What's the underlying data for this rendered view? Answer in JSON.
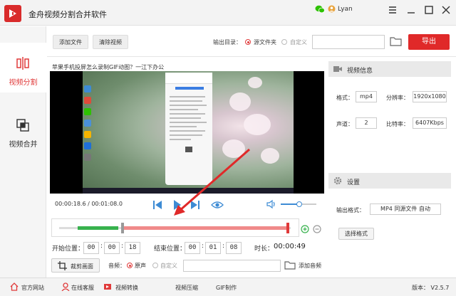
{
  "app": {
    "title": "金舟视频分割合并软件"
  },
  "user": {
    "name": "Lyan"
  },
  "sidebar": {
    "items": [
      {
        "label": "视频分割"
      },
      {
        "label": "视频合并"
      }
    ]
  },
  "toolbar": {
    "add_file": "添加文件",
    "clear_video": "清除视频",
    "output_dir_label": "输出目录：",
    "option_source": "源文件夹",
    "option_custom": "自定义",
    "export": "导出"
  },
  "video": {
    "title": "苹果手机投屏怎么录制GIF动图？一江下办公",
    "time_display": "00:00:18.6 / 00:01:08.0"
  },
  "timing": {
    "start_label": "开始位置：",
    "start": {
      "h": "00",
      "m": "00",
      "s": "18"
    },
    "end_label": "结束位置：",
    "end": {
      "h": "00",
      "m": "01",
      "s": "08"
    },
    "duration_label": "时长：",
    "duration": "00:00:49",
    "selection_start_fraction": 0.274,
    "selection_end_fraction": 1.0
  },
  "tools": {
    "crop": "裁剪画面",
    "audio_label": "音频：",
    "audio_original": "原声",
    "audio_custom": "自定义",
    "add_audio": "添加音频"
  },
  "right_panel": {
    "info_title": "视频信息",
    "format_label": "格式：",
    "format": "mp4",
    "resolution_label": "分辨率：",
    "resolution": "1920x1080",
    "channel_label": "声道：",
    "channel": "2",
    "bitrate_label": "比特率：",
    "bitrate": "6407Kbps",
    "settings_title": "设置",
    "output_format_label": "输出格式：",
    "output_format": "MP4 同源文件 自动",
    "choose_format": "选择格式"
  },
  "statusbar": {
    "official_site": "官方网站",
    "online_support": "在线客服",
    "video_convert": "视频转换",
    "video_compress": "视频压缩",
    "gif_make": "GIF制作",
    "version": "版本：  V2.5.7"
  },
  "colors": {
    "accent": "#e02929",
    "progress_green": "#37b24d",
    "selection_red": "#f08a8a",
    "link_blue": "#3d8bd4"
  }
}
